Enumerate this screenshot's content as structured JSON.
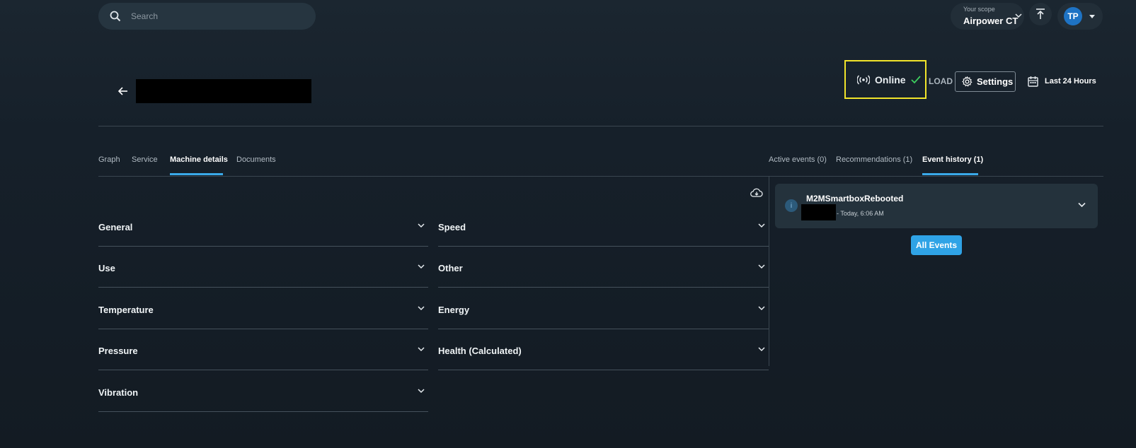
{
  "search": {
    "placeholder": "Search"
  },
  "scope": {
    "label": "Your scope",
    "value": "Airpower CT"
  },
  "user": {
    "initials": "TP"
  },
  "machine": {
    "status": "Online",
    "load_label": "LOAD",
    "settings_label": "Settings",
    "time_range": "Last 24 Hours"
  },
  "left_tabs": [
    "Graph",
    "Service",
    "Machine details",
    "Documents"
  ],
  "left_active_tab": "Machine details",
  "right_tabs": [
    "Active events (0)",
    "Recommendations (1)",
    "Event history (1)"
  ],
  "right_active_tab": "Event history (1)",
  "sections_left": [
    "General",
    "Use",
    "Temperature",
    "Pressure",
    "Vibration"
  ],
  "sections_right": [
    "Speed",
    "Other",
    "Energy",
    "Health (Calculated)"
  ],
  "event": {
    "title": "M2MSmartboxRebooted",
    "time": "- Today, 6:06 AM",
    "info_glyph": "i"
  },
  "all_events_label": "All Events",
  "colors": {
    "accent": "#3aa9e8",
    "highlight_box": "#f1e42a",
    "online_check": "#3ecf5e",
    "avatar": "#1e73c4"
  }
}
